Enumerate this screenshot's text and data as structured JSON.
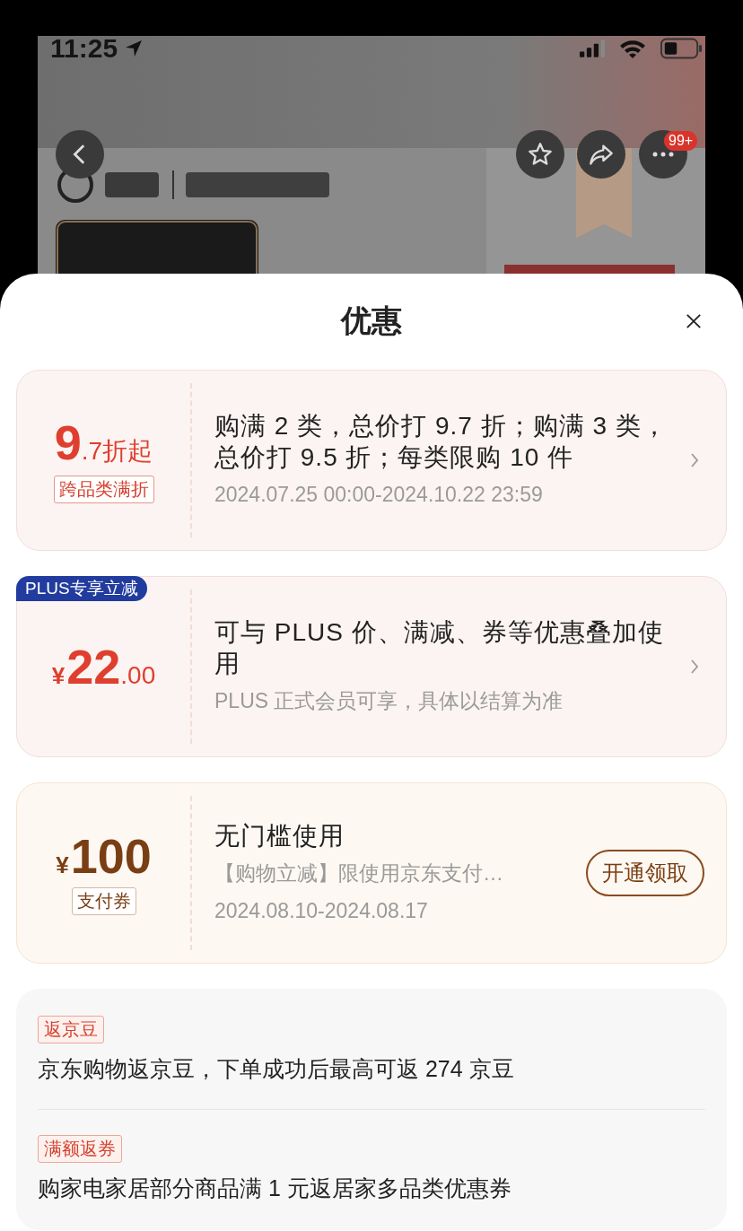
{
  "status_bar": {
    "time": "11:25"
  },
  "nav": {
    "badge": "99+"
  },
  "sheet": {
    "title": "优惠"
  },
  "offers": [
    {
      "kind": "discount",
      "value_main": "9",
      "value_suffix": ".7折起",
      "tag": "跨品类满折",
      "title": "购满 2 类，总价打 9.7 折；购满 3 类，总价打 9.5 折；每类限购 10 件",
      "subtitle": "2024.07.25 00:00-2024.10.22 23:59"
    },
    {
      "kind": "plus",
      "ribbon": "PLUS专享立减",
      "currency": "¥",
      "value_main": "22",
      "value_suffix": ".00",
      "title": "可与 PLUS 价、满减、券等优惠叠加使用",
      "subtitle": "PLUS 正式会员可享，具体以结算为准"
    },
    {
      "kind": "coupon",
      "currency": "¥",
      "value_main": "100",
      "tag": "支付券",
      "title": "无门槛使用",
      "detail": "【购物立减】限使用京东支付…",
      "subtitle": "2024.08.10-2024.08.17",
      "button": "开通领取"
    }
  ],
  "rebates": [
    {
      "tag": "返京豆",
      "text": "京东购物返京豆，下单成功后最高可返 274 京豆"
    },
    {
      "tag": "满额返券",
      "text": "购家电家居部分商品满 1 元返居家多品类优惠券"
    }
  ]
}
